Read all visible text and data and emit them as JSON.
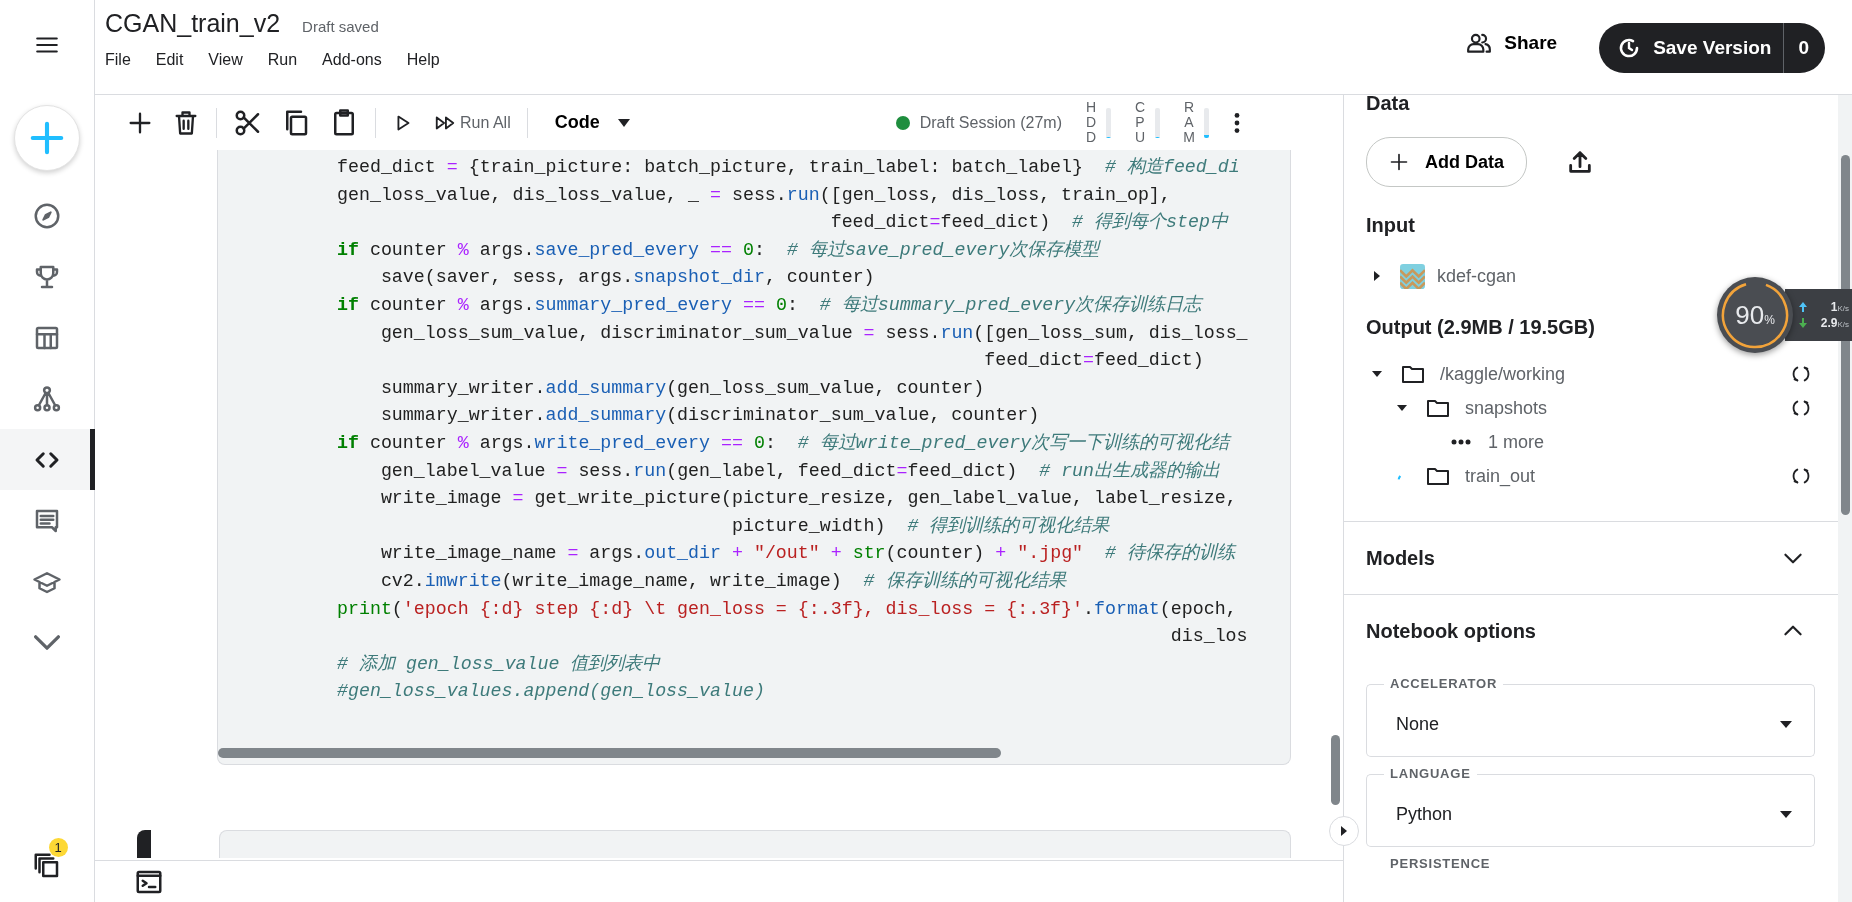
{
  "header": {
    "title": "CGAN_train_v2",
    "status": "Draft saved",
    "menu": [
      "File",
      "Edit",
      "View",
      "Run",
      "Add-ons",
      "Help"
    ],
    "share": "Share",
    "save_version": "Save Version",
    "version_count": "0"
  },
  "rail": {
    "items": [
      {
        "selected": false
      },
      {
        "selected": false
      },
      {
        "selected": false
      },
      {
        "selected": false
      },
      {
        "selected": true
      },
      {
        "selected": false
      },
      {
        "selected": false
      },
      {
        "selected": false
      }
    ],
    "badge": "1"
  },
  "toolbar": {
    "run_all": "Run All",
    "cell_type": "Code",
    "session": "Draft Session (27m)",
    "meters": [
      {
        "label": "HDD",
        "level": 0.03
      },
      {
        "label": "CPU",
        "level": 0.03
      },
      {
        "label": "RAM",
        "level": 0.08
      }
    ]
  },
  "code_lines": [
    [
      {
        "kind": "plain",
        "text": "feed_dict "
      },
      {
        "kind": "op",
        "text": "="
      },
      {
        "kind": "plain",
        "text": " {train_picture: batch_picture, train_label: batch_label}  "
      },
      {
        "kind": "comment",
        "text": "# 构造feed_di"
      }
    ],
    [
      {
        "kind": "plain",
        "text": "gen_loss_value, dis_loss_value, _ "
      },
      {
        "kind": "op",
        "text": "="
      },
      {
        "kind": "plain",
        "text": " sess."
      },
      {
        "kind": "attr",
        "text": "run"
      },
      {
        "kind": "plain",
        "text": "([gen_loss, dis_loss, train_op],"
      }
    ],
    [
      {
        "kind": "plain",
        "text": "                                             feed_dict"
      },
      {
        "kind": "op",
        "text": "="
      },
      {
        "kind": "plain",
        "text": "feed_dict)  "
      },
      {
        "kind": "comment",
        "text": "# 得到每个step中"
      }
    ],
    [
      {
        "kind": "keyword",
        "text": "if"
      },
      {
        "kind": "plain",
        "text": " counter "
      },
      {
        "kind": "op",
        "text": "%"
      },
      {
        "kind": "plain",
        "text": " args."
      },
      {
        "kind": "attr",
        "text": "save_pred_every"
      },
      {
        "kind": "op",
        "text": " == "
      },
      {
        "kind": "number",
        "text": "0"
      },
      {
        "kind": "plain",
        "text": ":  "
      },
      {
        "kind": "comment",
        "text": "# 每过save_pred_every次保存模型"
      }
    ],
    [
      {
        "kind": "plain",
        "text": "    save(saver, sess, args."
      },
      {
        "kind": "attr",
        "text": "snapshot_dir"
      },
      {
        "kind": "plain",
        "text": ", counter)"
      }
    ],
    [
      {
        "kind": "keyword",
        "text": "if"
      },
      {
        "kind": "plain",
        "text": " counter "
      },
      {
        "kind": "op",
        "text": "%"
      },
      {
        "kind": "plain",
        "text": " args."
      },
      {
        "kind": "attr",
        "text": "summary_pred_every"
      },
      {
        "kind": "op",
        "text": " == "
      },
      {
        "kind": "number",
        "text": "0"
      },
      {
        "kind": "plain",
        "text": ":  "
      },
      {
        "kind": "comment",
        "text": "# 每过summary_pred_every次保存训练日志"
      }
    ],
    [
      {
        "kind": "plain",
        "text": "    gen_loss_sum_value, discriminator_sum_value "
      },
      {
        "kind": "op",
        "text": "="
      },
      {
        "kind": "plain",
        "text": " sess."
      },
      {
        "kind": "attr",
        "text": "run"
      },
      {
        "kind": "plain",
        "text": "([gen_loss_sum, dis_loss_"
      }
    ],
    [
      {
        "kind": "plain",
        "text": "                                                           feed_dict"
      },
      {
        "kind": "op",
        "text": "="
      },
      {
        "kind": "plain",
        "text": "feed_dict)"
      }
    ],
    [
      {
        "kind": "plain",
        "text": "    summary_writer."
      },
      {
        "kind": "attr",
        "text": "add_summary"
      },
      {
        "kind": "plain",
        "text": "(gen_loss_sum_value, counter)"
      }
    ],
    [
      {
        "kind": "plain",
        "text": "    summary_writer."
      },
      {
        "kind": "attr",
        "text": "add_summary"
      },
      {
        "kind": "plain",
        "text": "(discriminator_sum_value, counter)"
      }
    ],
    [
      {
        "kind": "keyword",
        "text": "if"
      },
      {
        "kind": "plain",
        "text": " counter "
      },
      {
        "kind": "op",
        "text": "%"
      },
      {
        "kind": "plain",
        "text": " args."
      },
      {
        "kind": "attr",
        "text": "write_pred_every"
      },
      {
        "kind": "op",
        "text": " == "
      },
      {
        "kind": "number",
        "text": "0"
      },
      {
        "kind": "plain",
        "text": ":  "
      },
      {
        "kind": "comment",
        "text": "# 每过write_pred_every次写一下训练的可视化结"
      }
    ],
    [
      {
        "kind": "plain",
        "text": "    gen_label_value "
      },
      {
        "kind": "op",
        "text": "="
      },
      {
        "kind": "plain",
        "text": " sess."
      },
      {
        "kind": "attr",
        "text": "run"
      },
      {
        "kind": "plain",
        "text": "(gen_label, feed_dict"
      },
      {
        "kind": "op",
        "text": "="
      },
      {
        "kind": "plain",
        "text": "feed_dict)  "
      },
      {
        "kind": "comment",
        "text": "# run出生成器的输出"
      }
    ],
    [
      {
        "kind": "plain",
        "text": "    write_image "
      },
      {
        "kind": "op",
        "text": "="
      },
      {
        "kind": "plain",
        "text": " get_write_picture(picture_resize, gen_label_value, label_resize,"
      }
    ],
    [
      {
        "kind": "plain",
        "text": "                                    picture_width)  "
      },
      {
        "kind": "comment",
        "text": "# 得到训练的可视化结果"
      }
    ],
    [
      {
        "kind": "plain",
        "text": "    write_image_name "
      },
      {
        "kind": "op",
        "text": "="
      },
      {
        "kind": "plain",
        "text": " args."
      },
      {
        "kind": "attr",
        "text": "out_dir"
      },
      {
        "kind": "op",
        "text": " + "
      },
      {
        "kind": "string",
        "text": "\"/out\""
      },
      {
        "kind": "op",
        "text": " + "
      },
      {
        "kind": "builtin",
        "text": "str"
      },
      {
        "kind": "plain",
        "text": "(counter) "
      },
      {
        "kind": "op",
        "text": "+ "
      },
      {
        "kind": "string",
        "text": "\".jpg\""
      },
      {
        "kind": "comment",
        "text": "  # 待保存的训练"
      }
    ],
    [
      {
        "kind": "plain",
        "text": "    cv2."
      },
      {
        "kind": "attr",
        "text": "imwrite"
      },
      {
        "kind": "plain",
        "text": "(write_image_name, write_image)  "
      },
      {
        "kind": "comment",
        "text": "# 保存训练的可视化结果"
      }
    ],
    [
      {
        "kind": "builtin",
        "text": "print"
      },
      {
        "kind": "plain",
        "text": "("
      },
      {
        "kind": "string",
        "text": "'epoch {:d} step {:d} \\t gen_loss = {:.3f}, dis_loss = {:.3f}'"
      },
      {
        "kind": "plain",
        "text": "."
      },
      {
        "kind": "attr",
        "text": "format"
      },
      {
        "kind": "plain",
        "text": "(epoch,"
      }
    ],
    [
      {
        "kind": "plain",
        "text": "                                                                            dis_los"
      }
    ],
    [
      {
        "kind": "comment",
        "text": "# 添加 gen_loss_value 值到列表中"
      }
    ],
    [
      {
        "kind": "comment",
        "text": "#gen_loss_values.append(gen_loss_value)"
      }
    ]
  ],
  "panel": {
    "data_title": "Data",
    "add_data": "Add Data",
    "input_title": "Input",
    "inputs": [
      {
        "name": "kdef-cgan",
        "expanded": false
      }
    ],
    "output_title": "Output (2.9MB / 19.5GB)",
    "output_tree": [
      {
        "kind": "folder",
        "name": "/kaggle/working",
        "expanded": true,
        "children": [
          {
            "kind": "folder",
            "name": "snapshots",
            "expanded": true,
            "children": [
              {
                "kind": "more",
                "name": "1 more"
              }
            ]
          },
          {
            "kind": "folder",
            "name": "train_out",
            "loading": true
          }
        ]
      }
    ],
    "sections": [
      {
        "title": "Models",
        "expanded": false
      },
      {
        "title": "Notebook options",
        "expanded": true
      }
    ],
    "options": [
      {
        "label": "ACCELERATOR",
        "value": "None"
      },
      {
        "label": "LANGUAGE",
        "value": "Python"
      }
    ],
    "next_option_label": "PERSISTENCE"
  },
  "monitor": {
    "percent": "90",
    "unit": "%",
    "level": 0.9,
    "up": "1",
    "up_unit": "K/s",
    "down": "2.9",
    "down_unit": "K/s"
  }
}
